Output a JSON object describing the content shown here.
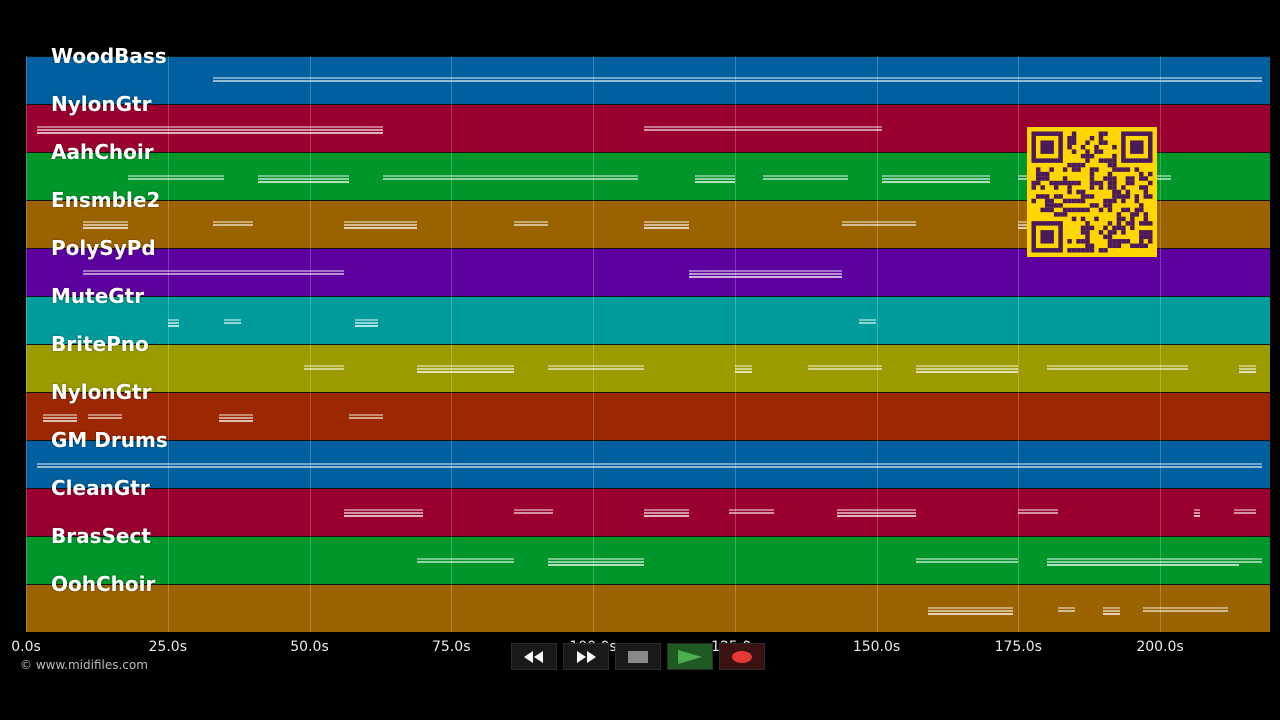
{
  "tracks": [
    {
      "name": "WoodBass",
      "color": "#005f9e"
    },
    {
      "name": "NylonGtr",
      "color": "#99002f"
    },
    {
      "name": "AahChoir",
      "color": "#00962a"
    },
    {
      "name": "Ensmble2",
      "color": "#9b6200"
    },
    {
      "name": "PolySyPd",
      "color": "#5c009e"
    },
    {
      "name": "MuteGtr",
      "color": "#009b9b"
    },
    {
      "name": "BritePno",
      "color": "#9b9b00"
    },
    {
      "name": "NylonGtr",
      "color": "#9b2800"
    },
    {
      "name": "GM Drums",
      "color": "#005f9e"
    },
    {
      "name": "CleanGtr",
      "color": "#99002f"
    },
    {
      "name": "BrasSect",
      "color": "#00962a"
    },
    {
      "name": "OohChoir",
      "color": "#9b6200"
    }
  ],
  "timeline": {
    "max_seconds": 219,
    "ticks": [
      "0.0s",
      "25.0s",
      "50.0s",
      "75.0s",
      "100.0s",
      "125.0s",
      "150.0s",
      "175.0s",
      "200.0s"
    ],
    "tick_values": [
      0,
      25,
      50,
      75,
      100,
      125,
      150,
      175,
      200
    ]
  },
  "note_segments": [
    [
      [
        33,
        218
      ]
    ],
    [
      [
        2,
        63
      ],
      [
        109,
        151
      ]
    ],
    [
      [
        18,
        35
      ],
      [
        41,
        57
      ],
      [
        63,
        108
      ],
      [
        118,
        125
      ],
      [
        130,
        145
      ],
      [
        151,
        170
      ],
      [
        175,
        202
      ]
    ],
    [
      [
        10,
        18
      ],
      [
        33,
        40
      ],
      [
        56,
        69
      ],
      [
        86,
        92
      ],
      [
        109,
        117
      ],
      [
        144,
        157
      ],
      [
        175,
        178
      ]
    ],
    [
      [
        10,
        56
      ],
      [
        117,
        144
      ]
    ],
    [
      [
        25,
        27
      ],
      [
        35,
        38
      ],
      [
        58,
        62
      ],
      [
        147,
        150
      ]
    ],
    [
      [
        49,
        56
      ],
      [
        69,
        86
      ],
      [
        92,
        109
      ],
      [
        125,
        128
      ],
      [
        138,
        151
      ],
      [
        157,
        175
      ],
      [
        180,
        205
      ],
      [
        214,
        217
      ]
    ],
    [
      [
        3,
        9
      ],
      [
        11,
        17
      ],
      [
        34,
        40
      ],
      [
        57,
        63
      ]
    ],
    [
      [
        2,
        218
      ]
    ],
    [
      [
        56,
        70
      ],
      [
        86,
        93
      ],
      [
        109,
        117
      ],
      [
        124,
        132
      ],
      [
        143,
        157
      ],
      [
        175,
        182
      ],
      [
        206,
        207
      ],
      [
        213,
        217
      ]
    ],
    [
      [
        69,
        86
      ],
      [
        92,
        109
      ],
      [
        157,
        175
      ],
      [
        180,
        214
      ],
      [
        214,
        218
      ]
    ],
    [
      [
        159,
        174
      ],
      [
        182,
        185
      ],
      [
        190,
        193
      ],
      [
        197,
        212
      ]
    ]
  ],
  "copyright": "© www.midifiles.com",
  "controls": {
    "rewind_icon": "rewind-icon",
    "fast_forward_icon": "fast-forward-icon",
    "stop_icon": "stop-icon",
    "play_icon": "play-icon",
    "record_icon": "record-icon",
    "play_color": "#4caf50",
    "record_color": "#e53935"
  },
  "qr_code": {
    "color": "#ffd600",
    "dark": "#4a1a5a"
  }
}
